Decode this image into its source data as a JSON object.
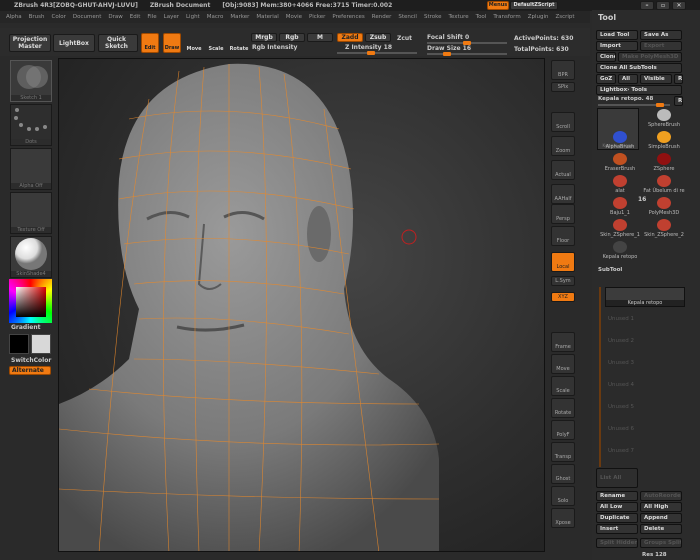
{
  "titlebar": {
    "app": "ZBrush 4R3[ZOBQ-GHUT-AHVJ-LUVU]",
    "document": "ZBrush Document",
    "info": "[Obj:9083] Mem:380+4066 Free:3715 Timer:0.002",
    "menus_button": "Menus",
    "script": "DefaultZScript"
  },
  "menubar": [
    "Alpha",
    "Brush",
    "Color",
    "Document",
    "Draw",
    "Edit",
    "File",
    "Layer",
    "Light",
    "Macro",
    "Marker",
    "Material",
    "Movie",
    "Picker",
    "Preferences",
    "Render",
    "Stencil",
    "Stroke",
    "Texture",
    "Tool",
    "Transform",
    "Zplugin",
    "Zscript"
  ],
  "toolbar": {
    "projection_master": "Projection Master",
    "lightbox": "LightBox",
    "quick_sketch": "Quick Sketch",
    "edit": "Edit",
    "draw": "Draw",
    "move": "Move",
    "scale": "Scale",
    "rotate": "Rotate",
    "mrgb": "Mrgb",
    "rgb": "Rgb",
    "m": "M",
    "rgb_intensity": "Rgb Intensity",
    "zadd": "Zadd",
    "zsub": "Zsub",
    "zcut": "Zcut",
    "z_intensity": "Z Intensity 18",
    "z_intensity_value": 18,
    "focal_shift": "Focal Shift 0",
    "focal_shift_value": 0,
    "draw_size": "Draw Size 16",
    "draw_size_value": 16,
    "active_points": "ActivePoints: 630",
    "total_points": "TotalPoints: 630"
  },
  "leftshelf": {
    "stroke": "Sketch 1",
    "alpha_dots": "Dots",
    "alpha": "Alpha Off",
    "texture": "Texture Off",
    "material": "SkinShade4",
    "gradient": "Gradient",
    "switch_color": "SwitchColor",
    "alternate": "Alternate",
    "main_color": "#000000",
    "secondary_color": "#d8d8d8"
  },
  "rightshelf": [
    "BPR",
    "SPix",
    "Scroll",
    "Zoom",
    "Actual",
    "AAHalf",
    "Persp",
    "Floor",
    "Local",
    "L.Sym",
    "XYZ",
    "",
    "",
    "Frame",
    "Move",
    "Scale",
    "Rotate",
    "PolyF",
    "Transp",
    "Ghost",
    "Solo",
    "Xpose"
  ],
  "tool": {
    "title": "Tool",
    "load_tool": "Load Tool",
    "save_as": "Save As",
    "import": "Import",
    "export": "Export",
    "clone": "Clone",
    "make_polymesh": "Make PolyMesh3D",
    "clone_all": "Clone All SubTools",
    "goz": "GoZ",
    "all": "All",
    "visible": "Visible",
    "r": "R",
    "lightbox_tools": "Lightbox› Tools",
    "current_tool": "Kepala retopo. 48",
    "current_thumb": "Kepala retopo",
    "items": [
      {
        "name": "SphereBrush",
        "color": "#bbbbbb"
      },
      {
        "name": "AlphaBrush",
        "color": "#3050d0"
      },
      {
        "name": "SimpleBrush",
        "color": "#f0a020"
      },
      {
        "name": "EraserBrush",
        "color": "#c05020"
      },
      {
        "name": "ZSphere",
        "color": "#901010"
      },
      {
        "name": "alat",
        "color": "#c04030"
      },
      {
        "name": "Fat Ùbelum di re",
        "color": "#c04030"
      },
      {
        "name": "Baju1_1",
        "color": "#c04030"
      },
      {
        "name": "PolyMesh3D",
        "color": "#c04030"
      },
      {
        "name": "Skin_ZSphere_1",
        "color": "#c04030"
      },
      {
        "name": "Skin_ZSphere_2",
        "color": "#c04030"
      },
      {
        "name": "Kepala retopo",
        "color": "#444444"
      }
    ],
    "count_badge": "16"
  },
  "subtool": {
    "title": "SubTool",
    "active": "Kepala retopo",
    "unused": [
      "Unused 1",
      "Unused 2",
      "Unused 3",
      "Unused 4",
      "Unused 5",
      "Unused 6",
      "Unused 7"
    ],
    "list_all": "List All",
    "rename": "Rename",
    "autoreorder": "AutoReorder",
    "all_low": "All Low",
    "all_high": "All High",
    "duplicate": "Duplicate",
    "append": "Append",
    "insert": "Insert",
    "delete": "Delete",
    "split_hidden": "Split Hidden",
    "groups_split": "Groups Split",
    "res": "Res 128"
  },
  "colors": {
    "accent": "#f07a12",
    "wire": "#e8892a"
  }
}
